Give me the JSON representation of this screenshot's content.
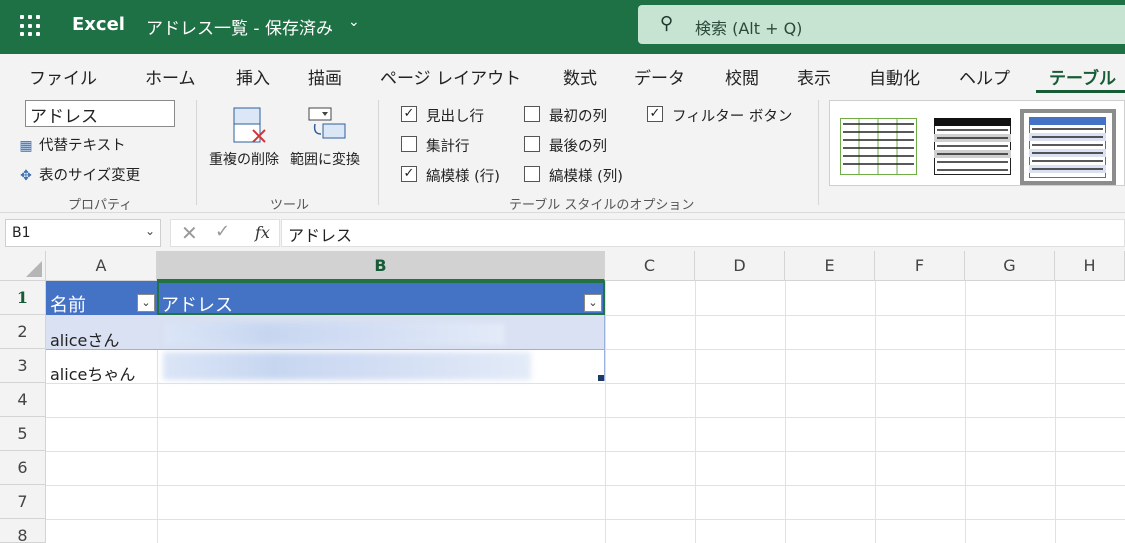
{
  "titlebar": {
    "app_name": "Excel",
    "doc_title": "アドレス一覧 - 保存済み",
    "search_placeholder": "検索 (Alt + Q)"
  },
  "ribbon_tabs": [
    "ファイル",
    "ホーム",
    "挿入",
    "描画",
    "ページ レイアウト",
    "数式",
    "データ",
    "校閲",
    "表示",
    "自動化",
    "ヘルプ",
    "テーブル"
  ],
  "active_tab": "テーブル",
  "properties": {
    "table_name": "アドレス",
    "alt_text": "代替テキスト",
    "resize_table": "表のサイズ変更",
    "label": "プロパティ"
  },
  "tools": {
    "remove_duplicates": "重複の削除",
    "convert_to_range": "範囲に変換",
    "label": "ツール"
  },
  "style_options": {
    "label": "テーブル スタイルのオプション",
    "header_row": {
      "label": "見出し行",
      "checked": true
    },
    "total_row": {
      "label": "集計行",
      "checked": false
    },
    "banded_rows": {
      "label": "縞模様 (行)",
      "checked": true
    },
    "first_column": {
      "label": "最初の列",
      "checked": false
    },
    "last_column": {
      "label": "最後の列",
      "checked": false
    },
    "banded_columns": {
      "label": "縞模様 (列)",
      "checked": false
    },
    "filter_button": {
      "label": "フィルター ボタン",
      "checked": true
    }
  },
  "formula_bar": {
    "cell_ref": "B1",
    "formula": "アドレス",
    "fx": "fx"
  },
  "columns": [
    "A",
    "B",
    "C",
    "D",
    "E",
    "F",
    "G",
    "H"
  ],
  "selected_column": "B",
  "rows": [
    "1",
    "2",
    "3",
    "4",
    "5",
    "6",
    "7",
    "8"
  ],
  "selected_row": "1",
  "table": {
    "headers": [
      "名前",
      "アドレス"
    ],
    "rows": [
      [
        "aliceさん",
        ""
      ],
      [
        "aliceちゃん",
        ""
      ]
    ]
  },
  "colors": {
    "brand": "#1e7145",
    "table_header": "#4472c4",
    "table_band": "#d9e1f2"
  }
}
